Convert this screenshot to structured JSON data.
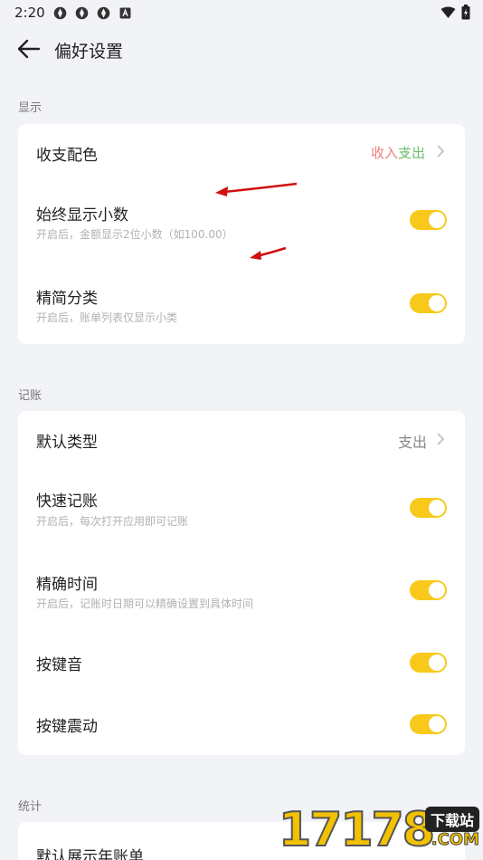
{
  "status": {
    "time": "2:20"
  },
  "header": {
    "title": "偏好设置"
  },
  "sections": {
    "display": {
      "title": "显示",
      "color_row": {
        "label": "收支配色",
        "income": "收入",
        "sep": "/",
        "expense": "支出",
        "income_color": "#ef7d7d",
        "expense_color": "#6cc06a"
      },
      "decimal_row": {
        "label": "始终显示小数",
        "sub": "开启后，金额显示2位小数（如100.00）",
        "on": true
      },
      "simple_category_row": {
        "label": "精简分类",
        "sub": "开启后，账单列表仅显示小类",
        "on": true
      }
    },
    "bookkeeping": {
      "title": "记账",
      "default_type_row": {
        "label": "默认类型",
        "value": "支出"
      },
      "quick_row": {
        "label": "快速记账",
        "sub": "开启后，每次打开应用即可记账",
        "on": true
      },
      "precise_time_row": {
        "label": "精确时间",
        "sub": "开启后，记账时日期可以精确设置到具体时间",
        "on": true
      },
      "key_sound_row": {
        "label": "按键音",
        "on": true
      },
      "key_vibrate_row": {
        "label": "按键震动",
        "on": true
      }
    },
    "stats": {
      "title": "统计",
      "annual_row": {
        "label": "默认展示年账单"
      }
    }
  },
  "watermark": {
    "digits": "17178",
    "badge": "下载站",
    "com": ".COM"
  },
  "colors": {
    "toggle_on": "#f8c91a",
    "background": "#f2f3f7"
  }
}
